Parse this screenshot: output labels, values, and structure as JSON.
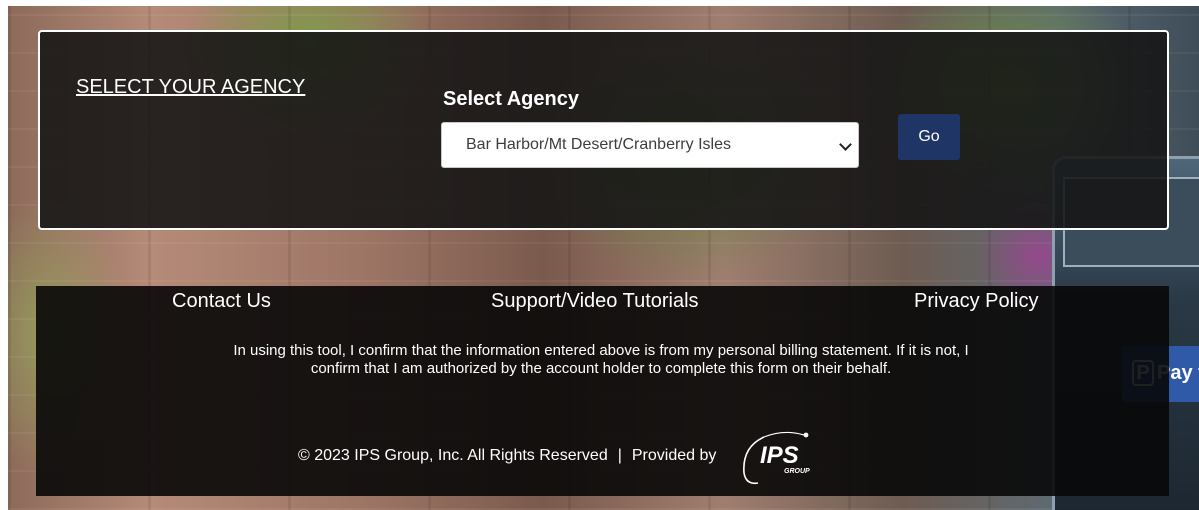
{
  "agency_panel": {
    "heading": "SELECT YOUR AGENCY",
    "select_label": "Select Agency",
    "selected_agency": "Bar Harbor/Mt Desert/Cranberry Isles",
    "go_label": "Go"
  },
  "footer": {
    "links": [
      "Contact Us",
      "Support/Video Tutorials",
      "Privacy Policy"
    ],
    "disclaimer": "In using this tool, I confirm that the information entered above is from my personal billing statement. If it is not, I confirm that I am authorized by the account holder to complete this form on their behalf.",
    "copyright": "© 2023 IPS Group, Inc. All Rights Reserved",
    "separator": "|",
    "provided_by": "Provided by",
    "logo_text": "IPS",
    "logo_subtext": "GROUP"
  },
  "background": {
    "sign_text": "Pay to"
  },
  "colors": {
    "go_button": "#1f3566",
    "panel_bg": "#141414",
    "text": "#ffffff"
  }
}
